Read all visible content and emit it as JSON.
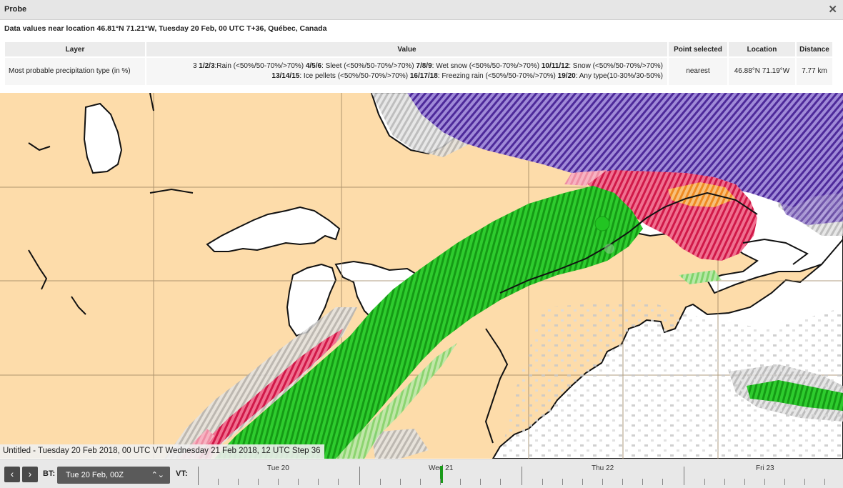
{
  "probe": {
    "title": "Probe",
    "close_icon": "close-icon",
    "subtitle": "Data values near location 46.81°N 71.21°W, Tuesday 20 Feb, 00 UTC T+36, Québec, Canada"
  },
  "table": {
    "headers": [
      "Layer",
      "Value",
      "Point selected",
      "Location",
      "Distance"
    ],
    "layer": "Most probable precipitation type (in %)",
    "value_line1": [
      {
        "text": "3 ",
        "bold": false
      },
      {
        "text": "1/2/3",
        "bold": true
      },
      {
        "text": ":Rain (<50%/50-70%/>70%) ",
        "bold": false
      },
      {
        "text": "4/5/6",
        "bold": true
      },
      {
        "text": ": Sleet (<50%/50-70%/>70%) ",
        "bold": false
      },
      {
        "text": "7/8/9",
        "bold": true
      },
      {
        "text": ": Wet snow (<50%/50-70%/>70%) ",
        "bold": false
      },
      {
        "text": "10/11/12",
        "bold": true
      },
      {
        "text": ": Snow (<50%/50-70%/>70%)",
        "bold": false
      }
    ],
    "value_line2": [
      {
        "text": "13/14/15",
        "bold": true
      },
      {
        "text": ": Ice pellets (<50%/50-70%/>70%) ",
        "bold": false
      },
      {
        "text": "16/17/18",
        "bold": true
      },
      {
        "text": ": Freezing rain (<50%/50-70%/>70%) ",
        "bold": false
      },
      {
        "text": "19/20",
        "bold": true
      },
      {
        "text": ": Any type(10-30%/30-50%)",
        "bold": false
      }
    ],
    "point_selected": "nearest",
    "location": "46.88°N 71.19°W",
    "distance": "7.77 km"
  },
  "map": {
    "caption": "Untitled - Tuesday 20 Feb 2018, 00 UTC VT Wednesday 21 Feb 2018, 12 UTC Step 36",
    "colors": {
      "land": "#fddcaa",
      "water": "#ffffff",
      "rain": "#2ecc2e",
      "rain_dark": "#159a15",
      "snow": "#6a3fb5",
      "freezing_rain": "#e0285a",
      "sleet": "#f0902a",
      "any_type": "#b0b0b0",
      "marker": "#22c422"
    }
  },
  "toolbar": {
    "prev_icon": "chevron-left-icon",
    "next_icon": "chevron-right-icon",
    "bt_label": "BT:",
    "bt_value": "Tue 20 Feb, 00Z",
    "vt_label": "VT:",
    "days": [
      "Tue 20",
      "Wed 21",
      "Thu 22",
      "Fri 23"
    ]
  }
}
